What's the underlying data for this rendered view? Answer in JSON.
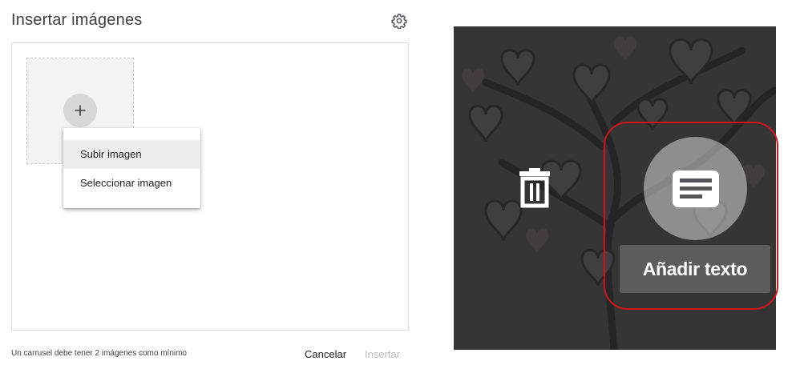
{
  "dialog": {
    "title": "Insertar imágenes",
    "settings_icon": "gear-icon",
    "add_icon": "plus-icon",
    "menu": {
      "items": [
        {
          "label": "Subir imagen",
          "active": true
        },
        {
          "label": "Seleccionar imagen",
          "active": false
        }
      ]
    },
    "footer": {
      "note": "Un carrusel debe tener 2 imágenes como mínimo",
      "cancel_label": "Cancelar",
      "insert_label": "Insertar"
    }
  },
  "preview": {
    "delete_icon": "trash-icon",
    "text_icon": "text-notes-icon",
    "tooltip_label": "Añadir texto",
    "highlight_color": "#d0151b"
  }
}
